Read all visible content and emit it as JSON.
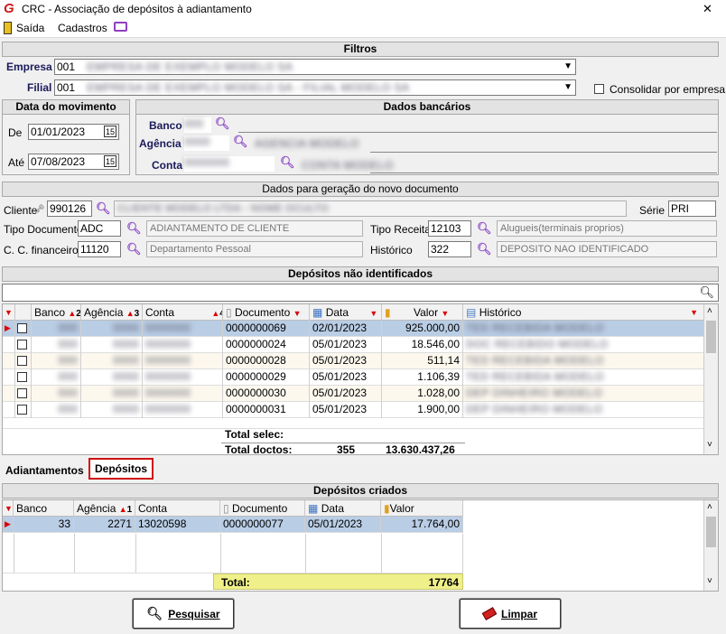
{
  "window": {
    "title": "CRC - Associação de depósitos à adiantamento",
    "close": "✕"
  },
  "menu": {
    "saida": "Saída",
    "cadastros": "Cadastros"
  },
  "filtros": {
    "header": "Filtros",
    "empresa_label": "Empresa",
    "empresa_code": "001",
    "empresa_name": "EMPRESA DE EXEMPLO MODELO SA",
    "filial_label": "Filial",
    "filial_code": "001",
    "filial_name": "EMPRESA DE EXEMPLO MODELO SA - FILIAL MODELO SA",
    "consolidar_label": "Consolidar por empresa"
  },
  "data_mov": {
    "header": "Data do movimento",
    "de_label": "De",
    "de_value": "01/01/2023",
    "ate_label": "Até",
    "ate_value": "07/08/2023",
    "cal": "15"
  },
  "dados_bancarios": {
    "header": "Dados bancários",
    "banco_label": "Banco",
    "banco_value": "000",
    "agencia_label": "Agência",
    "agencia_value": "0000",
    "agencia_name": "AGENCIA MODELO",
    "conta_label": "Conta",
    "conta_value": "0000000",
    "conta_name": "CONTA MODELO"
  },
  "novo_doc": {
    "header": "Dados para geração do novo documento",
    "cliente_label": "Cliente",
    "cliente_value": "990126",
    "cliente_name": "CLIENTE MODELO LTDA - NOME OCULTO",
    "serie_label": "Série",
    "serie_value": "PRI",
    "tipo_doc_label": "Tipo Documento",
    "tipo_doc_value": "ADC",
    "tipo_doc_desc": "ADIANTAMENTO DE CLIENTE",
    "tipo_receita_label": "Tipo Receita",
    "tipo_receita_value": "12103",
    "tipo_receita_desc": "Alugueis(terminais proprios)",
    "cc_label": "C. C. financeiro",
    "cc_value": "11120",
    "cc_desc": "Departamento Pessoal",
    "historico_label": "Histórico",
    "historico_value": "322",
    "historico_desc": "DEPOSITO NAO IDENTIFICADO"
  },
  "nao_identificados": {
    "header": "Depósitos não identificados",
    "columns": [
      "Banco",
      "Agência",
      "Conta",
      "Documento",
      "Data",
      "Valor",
      "Histórico"
    ],
    "sort": {
      "banco": "2",
      "agencia": "3",
      "conta": "4"
    },
    "rows": [
      {
        "banco": "000",
        "agencia": "0000",
        "conta": "0000000",
        "documento": "0000000069",
        "data": "02/01/2023",
        "valor": "925.000,00",
        "historico": "TED RECEBIDA MODELO"
      },
      {
        "banco": "000",
        "agencia": "0000",
        "conta": "0000000",
        "documento": "0000000024",
        "data": "05/01/2023",
        "valor": "18.546,00",
        "historico": "DOC RECEBIDO MODELO"
      },
      {
        "banco": "000",
        "agencia": "0000",
        "conta": "0000000",
        "documento": "0000000028",
        "data": "05/01/2023",
        "valor": "511,14",
        "historico": "TED RECEBIDA MODELO"
      },
      {
        "banco": "000",
        "agencia": "0000",
        "conta": "0000000",
        "documento": "0000000029",
        "data": "05/01/2023",
        "valor": "1.106,39",
        "historico": "TED RECEBIDA MODELO"
      },
      {
        "banco": "000",
        "agencia": "0000",
        "conta": "0000000",
        "documento": "0000000030",
        "data": "05/01/2023",
        "valor": "1.028,00",
        "historico": "DEP DINHEIRO MODELO"
      },
      {
        "banco": "000",
        "agencia": "0000",
        "conta": "0000000",
        "documento": "0000000031",
        "data": "05/01/2023",
        "valor": "1.900,00",
        "historico": "DEP DINHEIRO MODELO"
      }
    ],
    "total_selec_label": "Total selec:",
    "total_doctos_label": "Total doctos:",
    "total_doctos_count": "355",
    "total_doctos_value": "13.630.437,26"
  },
  "tabs": {
    "adiantamentos": "Adiantamentos",
    "depositos": "Depósitos"
  },
  "criados": {
    "header": "Depósitos criados",
    "columns": [
      "Banco",
      "Agência",
      "Conta",
      "Documento",
      "Data",
      "Valor"
    ],
    "agencia_sort": "1",
    "row": {
      "banco": "33",
      "agencia": "2271",
      "conta": "13020598",
      "documento": "0000000077",
      "data": "05/01/2023",
      "valor": "17.764,00"
    },
    "total_label": "Total:",
    "total_value": "17764"
  },
  "buttons": {
    "pesquisar": "Pesquisar",
    "limpar": "Limpar"
  }
}
